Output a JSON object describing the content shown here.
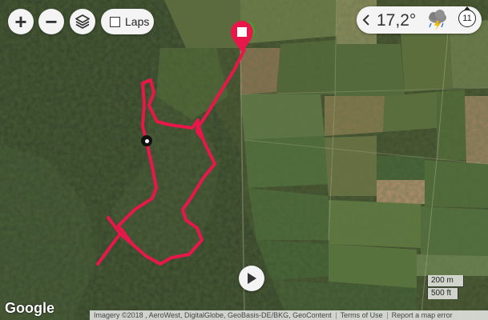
{
  "map_controls": {
    "zoom_in_label": "+",
    "zoom_out_label": "−",
    "layers_icon": "layers-icon",
    "laps_label": "Laps"
  },
  "weather": {
    "temperature": "17,2°",
    "condition_icon": "thunderstorm-cloud-icon",
    "wind_value": "11"
  },
  "scale": {
    "metric": "200 m",
    "imperial": "500 ft"
  },
  "branding": {
    "logo_text": "Google"
  },
  "attribution": {
    "imagery": "Imagery ©2018 , AeroWest, DigitalGlobe, GeoBasis-DE/BKG, GeoContent",
    "terms": "Terms of Use",
    "report": "Report a map error"
  },
  "route": {
    "color": "#e8174a",
    "finish_marker_color": "#e8174a",
    "start_marker_color": "#2fae2f"
  }
}
